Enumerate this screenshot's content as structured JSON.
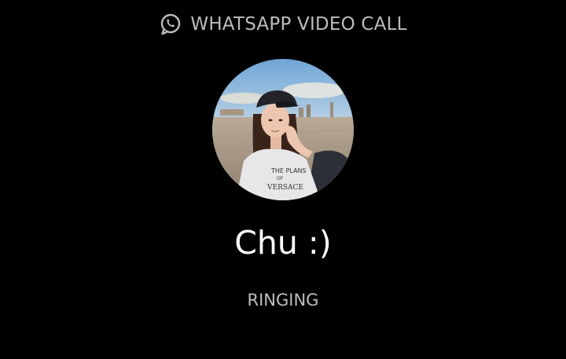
{
  "header": {
    "icon": "whatsapp-icon",
    "title": "WHATSAPP VIDEO CALL"
  },
  "contact": {
    "avatar": "contact-avatar-photo",
    "name": "Chu :)"
  },
  "call": {
    "status": "RINGING"
  },
  "colors": {
    "background": "#000000",
    "primary_text": "#ffffff",
    "secondary_text": "#bdbdbd"
  }
}
